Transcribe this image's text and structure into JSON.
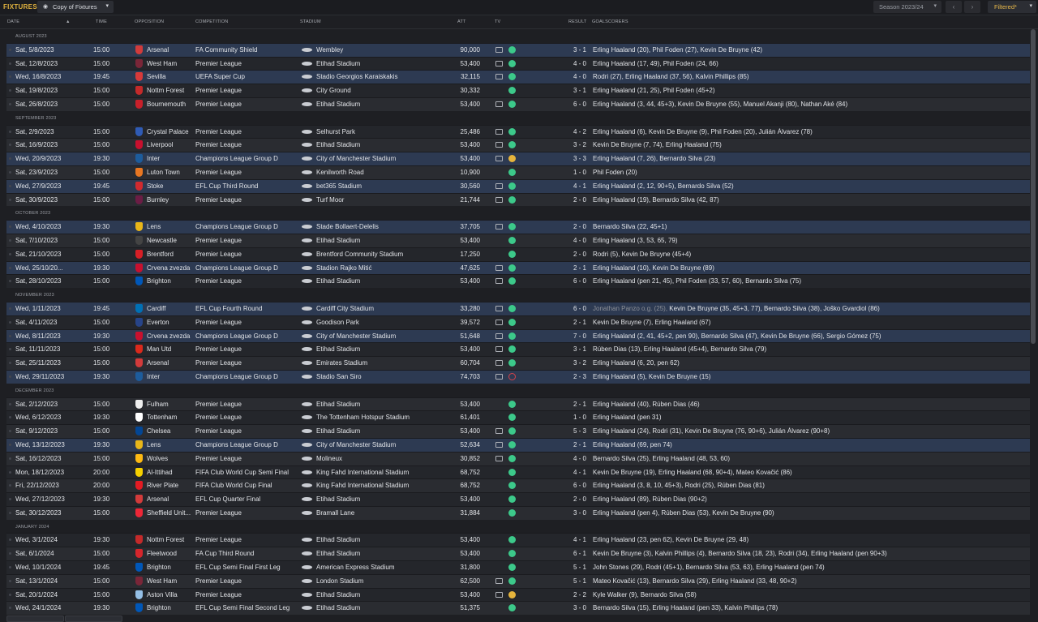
{
  "header": {
    "title": "FIXTURES",
    "view_name": "Copy of Fixtures",
    "season": "Season 2023/24",
    "filter": "Filtered*",
    "prev_icon": "chevron-left-icon",
    "next_icon": "chevron-right-icon"
  },
  "columns": {
    "date": "DATE",
    "time": "TIME",
    "opposition": "OPPOSITION",
    "competition": "COMPETITION",
    "stadium": "STADIUM",
    "att": "ATT",
    "tv": "TV",
    "result": "RESULT",
    "goalscorers": "GOALSCORERS"
  },
  "status_colors": {
    "win": "#3cc98a",
    "draw": "#e6b43c",
    "loss": "#d5434b"
  },
  "months": [
    {
      "label": "AUGUST 2023",
      "fixtures": [
        {
          "date": "Sat, 5/8/2023",
          "time": "15:00",
          "opp": "Arsenal",
          "badge": "#d23b3b",
          "comp": "FA Community Shield",
          "stadium": "Wembley",
          "att": "90,000",
          "tv": true,
          "status": "w",
          "result": "3 - 1",
          "scorers": "Erling Haaland (20), Phil Foden (27), Kevin De Bruyne (42)"
        },
        {
          "date": "Sat, 12/8/2023",
          "time": "15:00",
          "opp": "West Ham",
          "badge": "#7a2638",
          "comp": "Premier League",
          "stadium": "Etihad Stadium",
          "att": "53,400",
          "tv": true,
          "status": "w",
          "result": "4 - 0",
          "scorers": "Erling Haaland (17, 49), Phil Foden (24, 66)"
        },
        {
          "date": "Wed, 16/8/2023",
          "time": "19:45",
          "opp": "Sevilla",
          "badge": "#d83a3a",
          "comp": "UEFA Super Cup",
          "stadium": "Stadio Georgios Karaiskakis",
          "att": "32,115",
          "tv": true,
          "status": "w",
          "result": "4 - 0",
          "scorers": "Rodri (27), Erling Haaland (37, 56), Kalvin Phillips (85)"
        },
        {
          "date": "Sat, 19/8/2023",
          "time": "15:00",
          "opp": "Nottm Forest",
          "badge": "#c42a2a",
          "comp": "Premier League",
          "stadium": "City Ground",
          "att": "30,332",
          "tv": false,
          "status": "w",
          "result": "3 - 1",
          "scorers": "Erling Haaland (21, 25), Phil Foden (45+2)"
        },
        {
          "date": "Sat, 26/8/2023",
          "time": "15:00",
          "opp": "Bournemouth",
          "badge": "#c8202a",
          "comp": "Premier League",
          "stadium": "Etihad Stadium",
          "att": "53,400",
          "tv": true,
          "status": "w",
          "result": "6 - 0",
          "scorers": "Erling Haaland (3, 44, 45+3), Kevin De Bruyne (55), Manuel Akanji (80), Nathan Aké (84)"
        }
      ]
    },
    {
      "label": "SEPTEMBER 2023",
      "fixtures": [
        {
          "date": "Sat, 2/9/2023",
          "time": "15:00",
          "opp": "Crystal Palace",
          "badge": "#2f5bb5",
          "comp": "Premier League",
          "stadium": "Selhurst Park",
          "att": "25,486",
          "tv": true,
          "status": "w",
          "result": "4 - 2",
          "scorers": "Erling Haaland (6), Kevin De Bruyne (9), Phil Foden (20), Julián Álvarez (78)"
        },
        {
          "date": "Sat, 16/9/2023",
          "time": "15:00",
          "opp": "Liverpool",
          "badge": "#c8102e",
          "comp": "Premier League",
          "stadium": "Etihad Stadium",
          "att": "53,400",
          "tv": true,
          "status": "w",
          "result": "3 - 2",
          "scorers": "Kevin De Bruyne (7, 74), Erling Haaland (75)"
        },
        {
          "date": "Wed, 20/9/2023",
          "time": "19:30",
          "opp": "Inter",
          "badge": "#1d5c9c",
          "comp": "Champions League Group D",
          "stadium": "City of Manchester Stadium",
          "att": "53,400",
          "tv": true,
          "status": "d",
          "result": "3 - 3",
          "scorers": "Erling Haaland (7, 26), Bernardo Silva (23)"
        },
        {
          "date": "Sat, 23/9/2023",
          "time": "15:00",
          "opp": "Luton Town",
          "badge": "#e87722",
          "comp": "Premier League",
          "stadium": "Kenilworth Road",
          "att": "10,900",
          "tv": false,
          "status": "w",
          "result": "1 - 0",
          "scorers": "Phil Foden (20)"
        },
        {
          "date": "Wed, 27/9/2023",
          "time": "19:45",
          "opp": "Stoke",
          "badge": "#d12a2f",
          "comp": "EFL Cup Third Round",
          "stadium": "bet365 Stadium",
          "att": "30,560",
          "tv": true,
          "status": "w",
          "result": "4 - 1",
          "scorers": "Erling Haaland (2, 12, 90+5), Bernardo Silva (52)"
        },
        {
          "date": "Sat, 30/9/2023",
          "time": "15:00",
          "opp": "Burnley",
          "badge": "#6c1d45",
          "comp": "Premier League",
          "stadium": "Turf Moor",
          "att": "21,744",
          "tv": true,
          "status": "w",
          "result": "2 - 0",
          "scorers": "Erling Haaland (19), Bernardo Silva (42, 87)"
        }
      ]
    },
    {
      "label": "OCTOBER 2023",
      "fixtures": [
        {
          "date": "Wed, 4/10/2023",
          "time": "19:30",
          "opp": "Lens",
          "badge": "#e8b619",
          "comp": "Champions League Group D",
          "stadium": "Stade Bollaert-Delelis",
          "att": "37,705",
          "tv": true,
          "status": "w",
          "result": "2 - 0",
          "scorers": "Bernardo Silva (22, 45+1)"
        },
        {
          "date": "Sat, 7/10/2023",
          "time": "15:00",
          "opp": "Newcastle",
          "badge": "#444444",
          "comp": "Premier League",
          "stadium": "Etihad Stadium",
          "att": "53,400",
          "tv": false,
          "status": "w",
          "result": "4 - 0",
          "scorers": "Erling Haaland (3, 53, 65, 79)"
        },
        {
          "date": "Sat, 21/10/2023",
          "time": "15:00",
          "opp": "Brentford",
          "badge": "#d71f26",
          "comp": "Premier League",
          "stadium": "Brentford Community Stadium",
          "att": "17,250",
          "tv": false,
          "status": "w",
          "result": "2 - 0",
          "scorers": "Rodri (5), Kevin De Bruyne (45+4)"
        },
        {
          "date": "Wed, 25/10/20...",
          "time": "19:30",
          "opp": "Crvena zvezda",
          "badge": "#c8102e",
          "comp": "Champions League Group D",
          "stadium": "Stadion Rajko Mitić",
          "att": "47,625",
          "tv": true,
          "status": "w",
          "result": "2 - 1",
          "scorers": "Erling Haaland (10), Kevin De Bruyne (89)"
        },
        {
          "date": "Sat, 28/10/2023",
          "time": "15:00",
          "opp": "Brighton",
          "badge": "#0057b8",
          "comp": "Premier League",
          "stadium": "Etihad Stadium",
          "att": "53,400",
          "tv": true,
          "status": "w",
          "result": "6 - 0",
          "scorers": "Erling Haaland (pen 21, 45), Phil Foden (33, 57, 60), Bernardo Silva (75)"
        }
      ]
    },
    {
      "label": "NOVEMBER 2023",
      "fixtures": [
        {
          "date": "Wed, 1/11/2023",
          "time": "19:45",
          "opp": "Cardiff",
          "badge": "#0070b5",
          "comp": "EFL Cup Fourth Round",
          "stadium": "Cardiff City Stadium",
          "att": "33,280",
          "tv": true,
          "status": "w",
          "result": "6 - 0",
          "og": "Jonathan Panzo o.g. (25), ",
          "scorers": "Kevin De Bruyne (35, 45+3, 77), Bernardo Silva (38), Joško Gvardiol (86)"
        },
        {
          "date": "Sat, 4/11/2023",
          "time": "15:00",
          "opp": "Everton",
          "badge": "#274488",
          "comp": "Premier League",
          "stadium": "Goodison Park",
          "att": "39,572",
          "tv": true,
          "status": "w",
          "result": "2 - 1",
          "scorers": "Kevin De Bruyne (7), Erling Haaland (67)"
        },
        {
          "date": "Wed, 8/11/2023",
          "time": "19:30",
          "opp": "Crvena zvezda",
          "badge": "#c8102e",
          "comp": "Champions League Group D",
          "stadium": "City of Manchester Stadium",
          "att": "51,648",
          "tv": true,
          "status": "w",
          "result": "7 - 0",
          "scorers": "Erling Haaland (2, 41, 45+2, pen 90), Bernardo Silva (47), Kevin De Bruyne (66), Sergio Gómez (75)"
        },
        {
          "date": "Sat, 11/11/2023",
          "time": "15:00",
          "opp": "Man Utd",
          "badge": "#da291c",
          "comp": "Premier League",
          "stadium": "Etihad Stadium",
          "att": "53,400",
          "tv": true,
          "status": "w",
          "result": "3 - 1",
          "scorers": "Rúben Dias (13), Erling Haaland (45+4), Bernardo Silva (79)"
        },
        {
          "date": "Sat, 25/11/2023",
          "time": "15:00",
          "opp": "Arsenal",
          "badge": "#d23b3b",
          "comp": "Premier League",
          "stadium": "Emirates Stadium",
          "att": "60,704",
          "tv": true,
          "status": "w",
          "result": "3 - 2",
          "scorers": "Erling Haaland (6, 20, pen 62)"
        },
        {
          "date": "Wed, 29/11/2023",
          "time": "19:30",
          "opp": "Inter",
          "badge": "#1d5c9c",
          "comp": "Champions League Group D",
          "stadium": "Stadio San Siro",
          "att": "74,703",
          "tv": true,
          "status": "l",
          "result": "2 - 3",
          "scorers": "Erling Haaland (5), Kevin De Bruyne (15)"
        }
      ]
    },
    {
      "label": "DECEMBER 2023",
      "fixtures": [
        {
          "date": "Sat, 2/12/2023",
          "time": "15:00",
          "opp": "Fulham",
          "badge": "#eeeeee",
          "comp": "Premier League",
          "stadium": "Etihad Stadium",
          "att": "53,400",
          "tv": false,
          "status": "w",
          "result": "2 - 1",
          "scorers": "Erling Haaland (40), Rúben Dias (46)"
        },
        {
          "date": "Wed, 6/12/2023",
          "time": "19:30",
          "opp": "Tottenham",
          "badge": "#ffffff",
          "comp": "Premier League",
          "stadium": "The Tottenham Hotspur Stadium",
          "att": "61,401",
          "tv": false,
          "status": "w",
          "result": "1 - 0",
          "scorers": "Erling Haaland (pen 31)"
        },
        {
          "date": "Sat, 9/12/2023",
          "time": "15:00",
          "opp": "Chelsea",
          "badge": "#034694",
          "comp": "Premier League",
          "stadium": "Etihad Stadium",
          "att": "53,400",
          "tv": true,
          "status": "w",
          "result": "5 - 3",
          "scorers": "Erling Haaland (24), Rodri (31), Kevin De Bruyne (76, 90+6), Julián Álvarez (90+8)"
        },
        {
          "date": "Wed, 13/12/2023",
          "time": "19:30",
          "opp": "Lens",
          "badge": "#e8b619",
          "comp": "Champions League Group D",
          "stadium": "City of Manchester Stadium",
          "att": "52,634",
          "tv": true,
          "status": "w",
          "result": "2 - 1",
          "scorers": "Erling Haaland (69, pen 74)"
        },
        {
          "date": "Sat, 16/12/2023",
          "time": "15:00",
          "opp": "Wolves",
          "badge": "#fdb913",
          "comp": "Premier League",
          "stadium": "Molineux",
          "att": "30,852",
          "tv": true,
          "status": "w",
          "result": "4 - 0",
          "scorers": "Bernardo Silva (25), Erling Haaland (48, 53, 60)"
        },
        {
          "date": "Mon, 18/12/2023",
          "time": "20:00",
          "opp": "Al-Ittihad",
          "badge": "#f5d000",
          "comp": "FIFA Club World Cup Semi Final",
          "stadium": "King Fahd International Stadium",
          "att": "68,752",
          "tv": false,
          "status": "w",
          "result": "4 - 1",
          "scorers": "Kevin De Bruyne (19), Erling Haaland (68, 90+4), Mateo Kovačić (86)"
        },
        {
          "date": "Fri, 22/12/2023",
          "time": "20:00",
          "opp": "River Plate",
          "badge": "#e31b23",
          "comp": "FIFA Club World Cup Final",
          "stadium": "King Fahd International Stadium",
          "att": "68,752",
          "tv": false,
          "status": "w",
          "result": "6 - 0",
          "scorers": "Erling Haaland (3, 8, 10, 45+3), Rodri (25), Rúben Dias (81)"
        },
        {
          "date": "Wed, 27/12/2023",
          "time": "19:30",
          "opp": "Arsenal",
          "badge": "#d23b3b",
          "comp": "EFL Cup Quarter Final",
          "stadium": "Etihad Stadium",
          "att": "53,400",
          "tv": false,
          "status": "w",
          "result": "2 - 0",
          "scorers": "Erling Haaland (89), Rúben Dias (90+2)"
        },
        {
          "date": "Sat, 30/12/2023",
          "time": "15:00",
          "opp": "Sheffield Unit...",
          "badge": "#ee2737",
          "comp": "Premier League",
          "stadium": "Bramall Lane",
          "att": "31,884",
          "tv": false,
          "status": "w",
          "result": "3 - 0",
          "scorers": "Erling Haaland (pen 4), Rúben Dias (53), Kevin De Bruyne (90)"
        }
      ]
    },
    {
      "label": "JANUARY 2024",
      "fixtures": [
        {
          "date": "Wed, 3/1/2024",
          "time": "19:30",
          "opp": "Nottm Forest",
          "badge": "#c42a2a",
          "comp": "Premier League",
          "stadium": "Etihad Stadium",
          "att": "53,400",
          "tv": false,
          "status": "w",
          "result": "4 - 1",
          "scorers": "Erling Haaland (23, pen 62), Kevin De Bruyne (29, 48)"
        },
        {
          "date": "Sat, 6/1/2024",
          "time": "15:00",
          "opp": "Fleetwood",
          "badge": "#d6262c",
          "comp": "FA Cup Third Round",
          "stadium": "Etihad Stadium",
          "att": "53,400",
          "tv": false,
          "status": "w",
          "result": "6 - 1",
          "scorers": "Kevin De Bruyne (3), Kalvin Phillips (4), Bernardo Silva (18, 23), Rodri (34), Erling Haaland (pen 90+3)"
        },
        {
          "date": "Wed, 10/1/2024",
          "time": "19:45",
          "opp": "Brighton",
          "badge": "#0057b8",
          "comp": "EFL Cup Semi Final First Leg",
          "stadium": "American Express Stadium",
          "att": "31,800",
          "tv": false,
          "status": "w",
          "result": "5 - 1",
          "scorers": "John Stones (29), Rodri (45+1), Bernardo Silva (53, 63), Erling Haaland (pen 74)"
        },
        {
          "date": "Sat, 13/1/2024",
          "time": "15:00",
          "opp": "West Ham",
          "badge": "#7a2638",
          "comp": "Premier League",
          "stadium": "London Stadium",
          "att": "62,500",
          "tv": true,
          "status": "w",
          "result": "5 - 1",
          "scorers": "Mateo Kovačić (13), Bernardo Silva (29), Erling Haaland (33, 48, 90+2)"
        },
        {
          "date": "Sat, 20/1/2024",
          "time": "15:00",
          "opp": "Aston Villa",
          "badge": "#95bfe5",
          "comp": "Premier League",
          "stadium": "Etihad Stadium",
          "att": "53,400",
          "tv": true,
          "status": "d",
          "result": "2 - 2",
          "scorers": "Kyle Walker (9), Bernardo Silva (58)"
        },
        {
          "date": "Wed, 24/1/2024",
          "time": "19:30",
          "opp": "Brighton",
          "badge": "#0057b8",
          "comp": "EFL Cup Semi Final Second Leg",
          "stadium": "Etihad Stadium",
          "att": "51,375",
          "tv": false,
          "status": "w",
          "result": "3 - 0",
          "scorers": "Bernardo Silva (15), Erling Haaland (pen 33), Kalvin Phillips (78)"
        }
      ]
    }
  ]
}
